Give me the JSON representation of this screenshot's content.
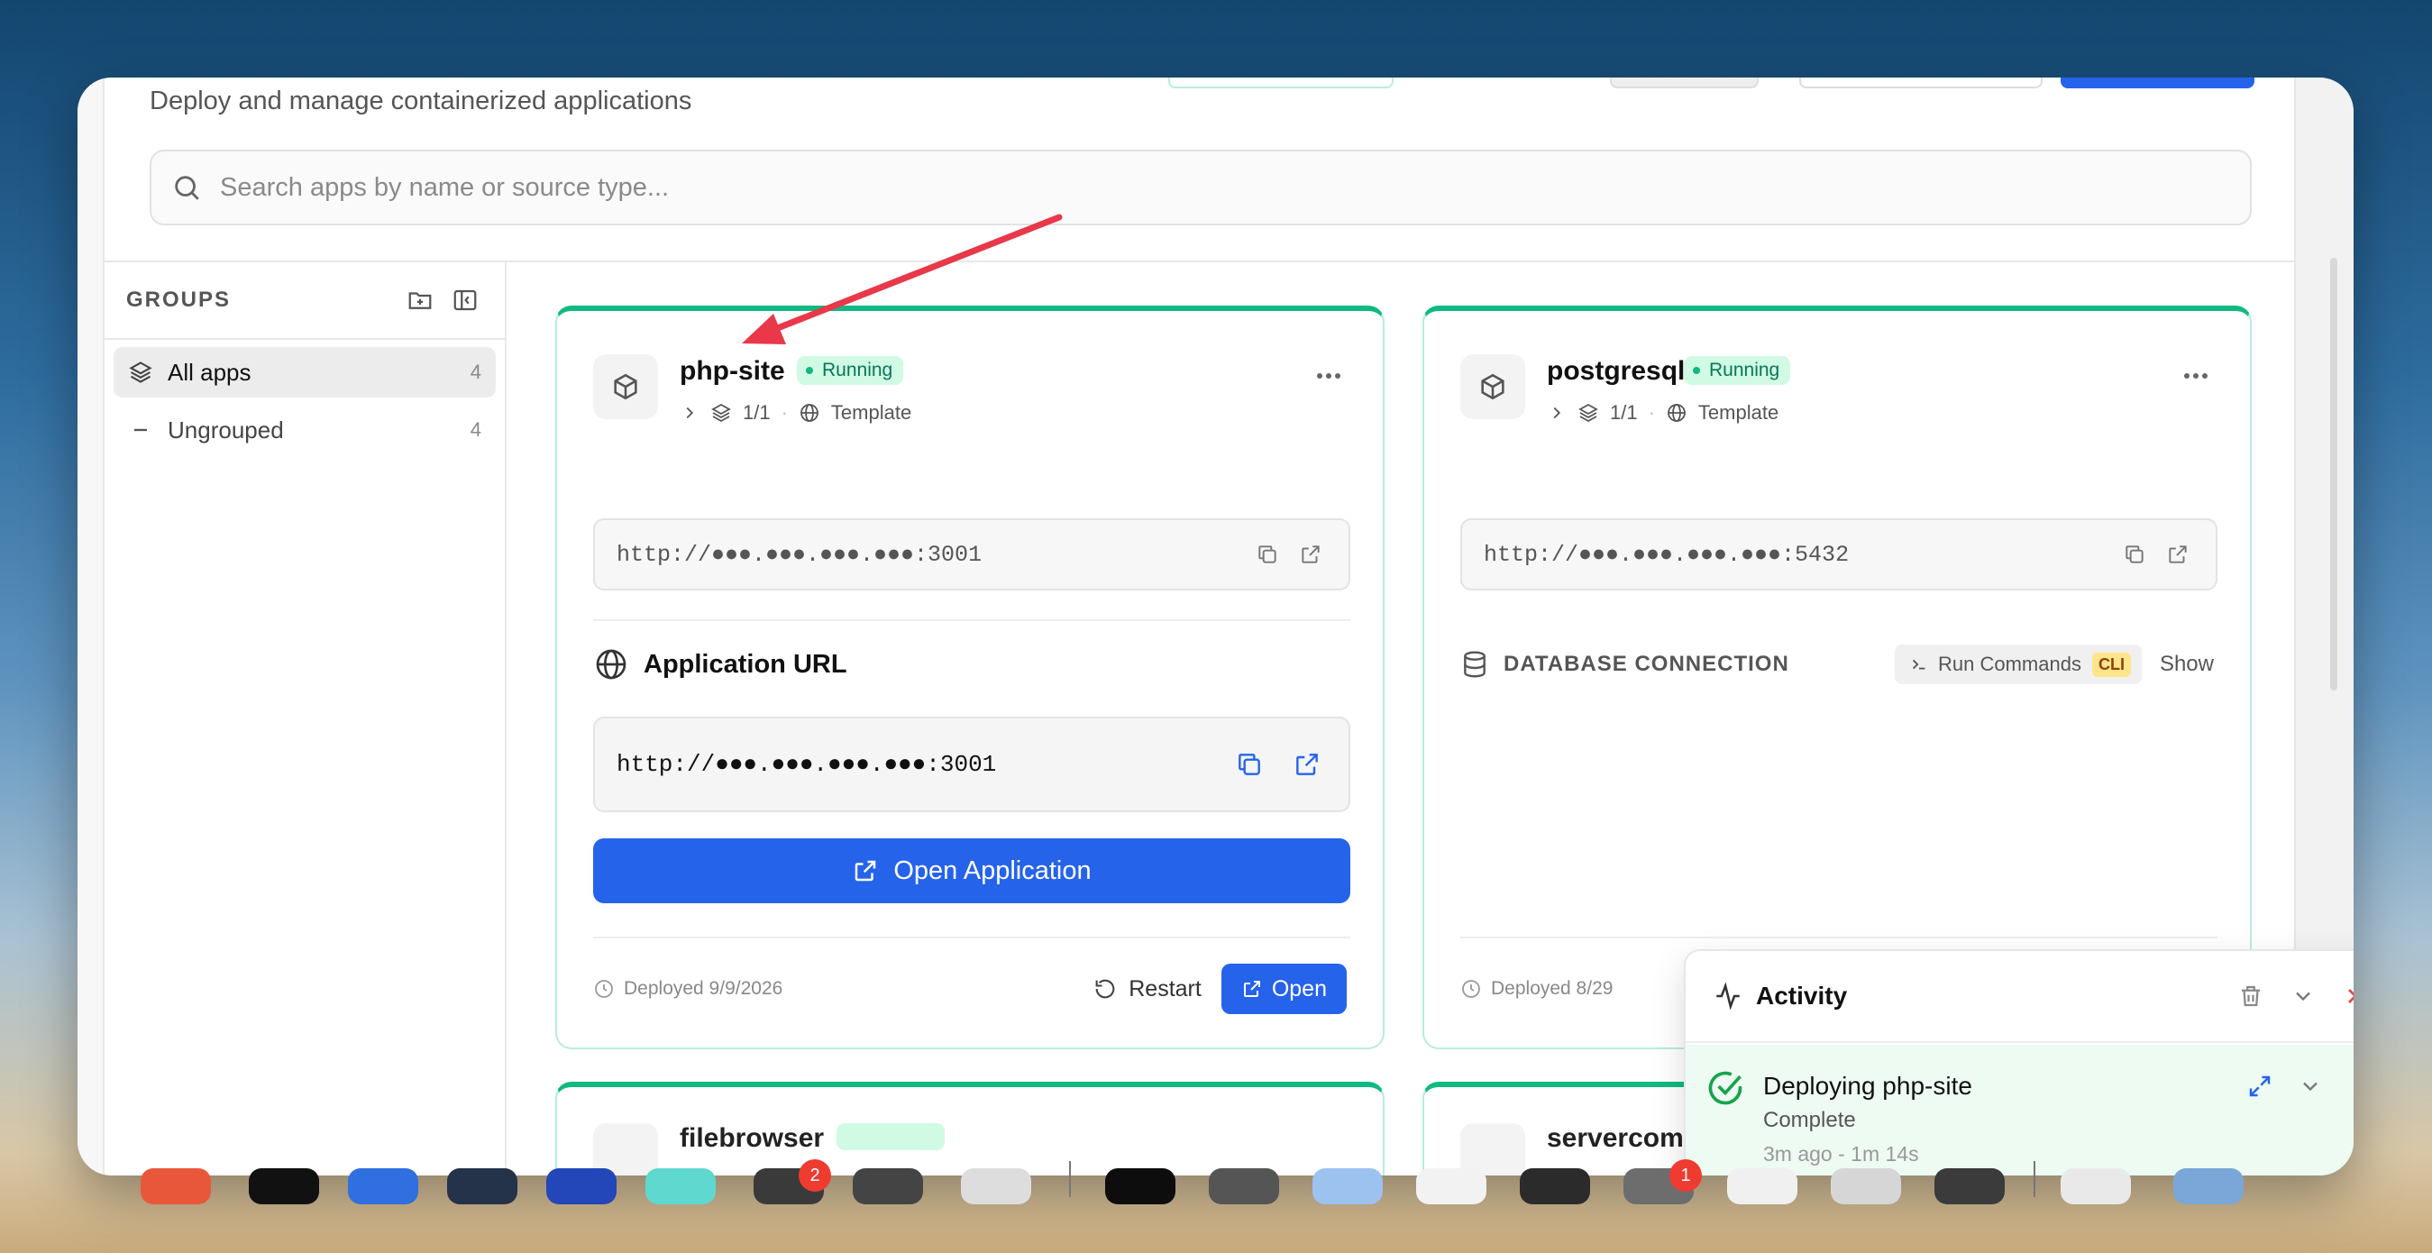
{
  "header": {
    "subtitle": "Deploy and manage containerized applications"
  },
  "search": {
    "placeholder": "Search apps by name or source type..."
  },
  "sidebar": {
    "title": "GROUPS",
    "items": [
      {
        "label": "All apps",
        "count": "4",
        "icon": "layers-icon"
      },
      {
        "label": "Ungrouped",
        "count": "4",
        "icon": "dash-icon"
      }
    ]
  },
  "apps": [
    {
      "name": "php-site",
      "status": "Running",
      "replicas": "1/1",
      "source": "Template",
      "url": "http://●●●.●●●.●●●.●●●:3001",
      "app_url_title": "Application URL",
      "app_url": "http://●●●.●●●.●●●.●●●:3001",
      "open_app_label": "Open Application",
      "deployed": "Deployed 9/9/2026",
      "restart_label": "Restart",
      "open_label": "Open"
    },
    {
      "name": "postgresql",
      "status": "Running",
      "replicas": "1/1",
      "source": "Template",
      "url": "http://●●●.●●●.●●●.●●●:5432",
      "db_title": "DATABASE CONNECTION",
      "run_commands_label": "Run Commands",
      "cli_badge": "CLI",
      "show_label": "Show",
      "deployed": "Deployed 8/29"
    },
    {
      "name": "filebrowser"
    },
    {
      "name": "servercompose-port-test-demo"
    }
  ],
  "activity": {
    "title": "Activity",
    "item": {
      "name": "Deploying php-site",
      "status": "Complete",
      "time": "3m ago  -  1m 14s"
    }
  },
  "dock": {
    "badges": [
      "2",
      "1"
    ]
  },
  "colors": {
    "accent": "#2563eb",
    "running": "#10b981",
    "annotation_arrow": "#e8384a"
  }
}
